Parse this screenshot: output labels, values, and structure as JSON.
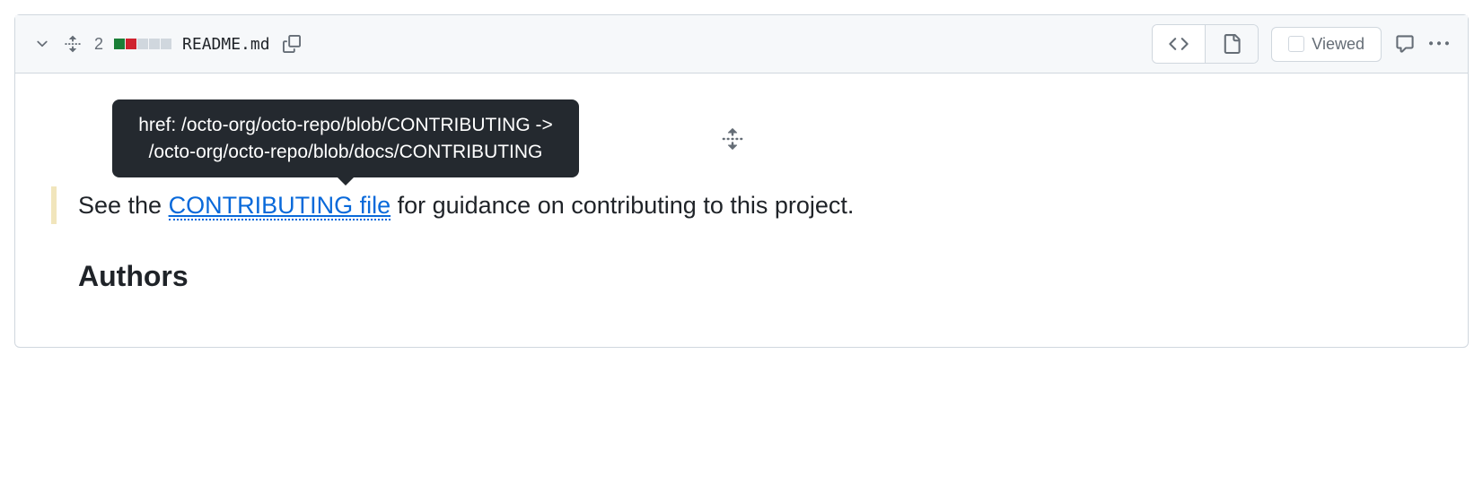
{
  "header": {
    "change_count": "2",
    "filename": "README.md",
    "viewed_label": "Viewed"
  },
  "diff": {
    "line_prefix": "See the ",
    "link_text": "CONTRIBUTING file",
    "line_suffix": " for guidance on contributing to this project."
  },
  "tooltip": {
    "text": "href: /octo-org/octo-repo/blob/CONTRIBUTING -> /octo-org/octo-repo/blob/docs/CONTRIBUTING"
  },
  "section": {
    "heading": "Authors"
  }
}
